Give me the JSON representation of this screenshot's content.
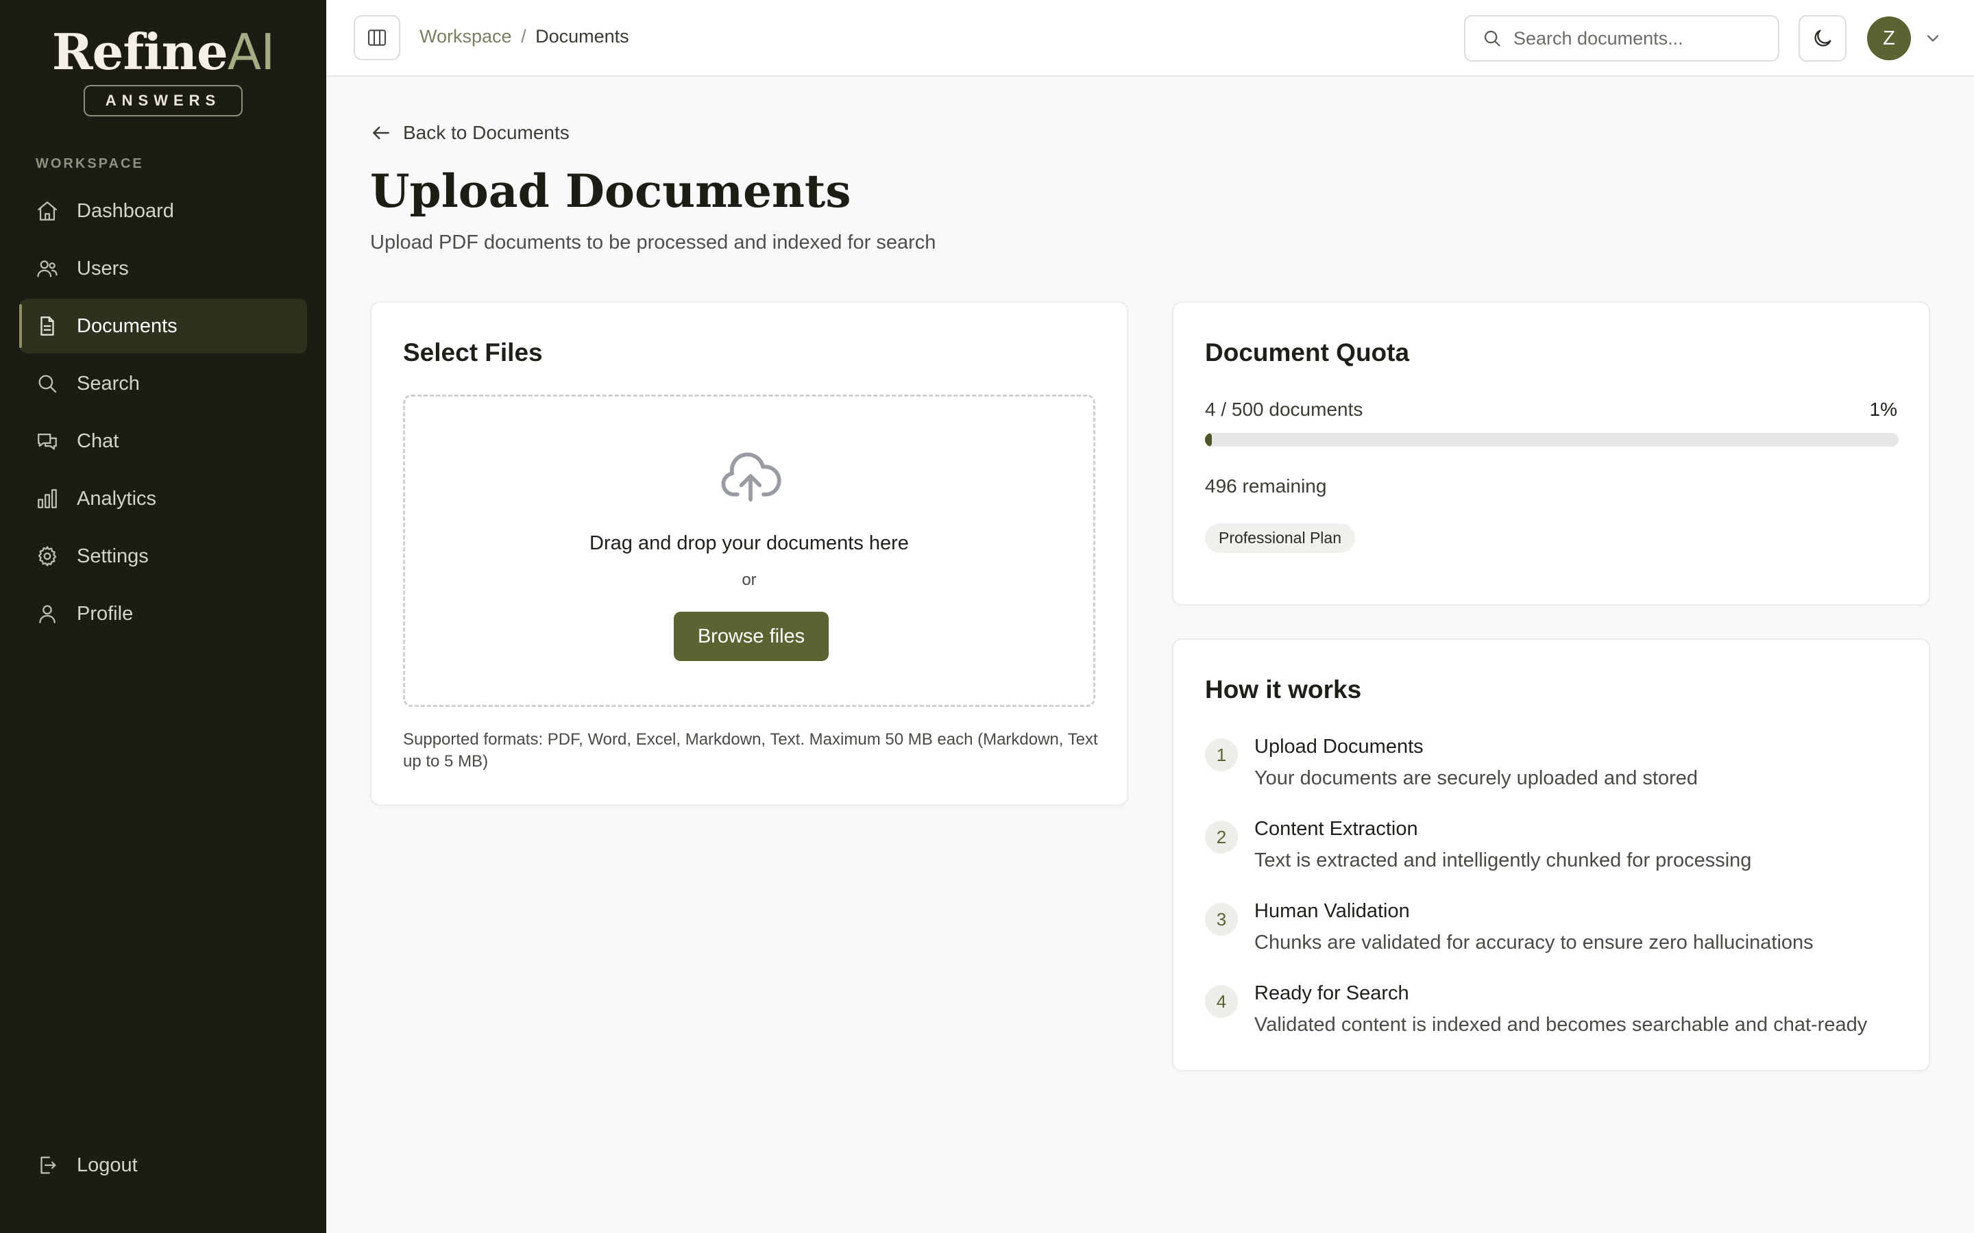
{
  "app": {
    "logo_main": "Refine",
    "logo_accent": "AI",
    "logo_tag": "ANSWERS"
  },
  "sidebar": {
    "section_label": "WORKSPACE",
    "items": [
      {
        "label": "Dashboard",
        "icon": "home-icon"
      },
      {
        "label": "Users",
        "icon": "users-icon"
      },
      {
        "label": "Documents",
        "icon": "document-icon",
        "active": true
      },
      {
        "label": "Search",
        "icon": "search-icon"
      },
      {
        "label": "Chat",
        "icon": "chat-icon"
      },
      {
        "label": "Analytics",
        "icon": "bar-chart-icon"
      },
      {
        "label": "Settings",
        "icon": "gear-icon"
      },
      {
        "label": "Profile",
        "icon": "user-icon"
      }
    ],
    "logout_label": "Logout"
  },
  "header": {
    "breadcrumb_root": "Workspace",
    "breadcrumb_separator": "/",
    "breadcrumb_current": "Documents",
    "search_placeholder": "Search documents...",
    "avatar_initial": "Z"
  },
  "main": {
    "back_label": "Back to Documents",
    "title": "Upload Documents",
    "subtitle": "Upload PDF documents to be processed and indexed for search"
  },
  "upload": {
    "title": "Select Files",
    "drop_text": "Drag and drop your documents here",
    "or_text": "or",
    "browse_label": "Browse files",
    "formats_text": "Supported formats: PDF, Word, Excel, Markdown, Text. Maximum 50 MB each (Markdown, Text up to 5 MB)"
  },
  "quota": {
    "title": "Document Quota",
    "count_text": "4 / 500 documents",
    "percent_text": "1%",
    "used": 4,
    "total": 500,
    "remaining_text": "496 remaining",
    "plan": "Professional Plan"
  },
  "how_it_works": {
    "title": "How it works",
    "steps": [
      {
        "num": "1",
        "title": "Upload Documents",
        "desc": "Your documents are securely uploaded and stored"
      },
      {
        "num": "2",
        "title": "Content Extraction",
        "desc": "Text is extracted and intelligently chunked for processing"
      },
      {
        "num": "3",
        "title": "Human Validation",
        "desc": "Chunks are validated for accuracy to ensure zero hallucinations"
      },
      {
        "num": "4",
        "title": "Ready for Search",
        "desc": "Validated content is indexed and becomes searchable and chat-ready"
      }
    ]
  },
  "colors": {
    "sidebar_bg": "#1c1c14",
    "accent": "#5d6232",
    "page_bg": "#f8f9fa"
  }
}
